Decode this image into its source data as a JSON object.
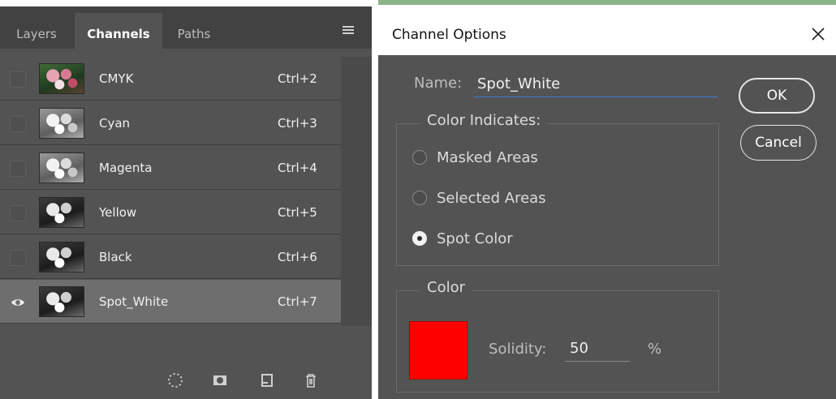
{
  "colors": {
    "panel_bg": "#535353",
    "tab_bar_bg": "#424242",
    "selected_row_bg": "#6e6e6e",
    "input_underline_accent": "#3a7bd5",
    "spot_color": "#ff0000"
  },
  "channels_panel": {
    "tabs": [
      {
        "label": "Layers",
        "active": false
      },
      {
        "label": "Channels",
        "active": true
      },
      {
        "label": "Paths",
        "active": false
      }
    ],
    "menu_icon": "hamburger-menu-icon",
    "channels": [
      {
        "name": "CMYK",
        "shortcut": "Ctrl+2",
        "visible": false,
        "selected": false
      },
      {
        "name": "Cyan",
        "shortcut": "Ctrl+3",
        "visible": false,
        "selected": false
      },
      {
        "name": "Magenta",
        "shortcut": "Ctrl+4",
        "visible": false,
        "selected": false
      },
      {
        "name": "Yellow",
        "shortcut": "Ctrl+5",
        "visible": false,
        "selected": false
      },
      {
        "name": "Black",
        "shortcut": "Ctrl+6",
        "visible": false,
        "selected": false
      },
      {
        "name": "Spot_White",
        "shortcut": "Ctrl+7",
        "visible": true,
        "selected": true
      }
    ],
    "bottom_icons": [
      "load-selection-icon",
      "save-selection-mask-icon",
      "new-channel-icon",
      "delete-channel-icon"
    ]
  },
  "dialog": {
    "title": "Channel Options",
    "close_icon": "close-icon",
    "name_label": "Name:",
    "name_value": "Spot_White",
    "ok_label": "OK",
    "cancel_label": "Cancel",
    "color_indicates": {
      "legend": "Color Indicates:",
      "options": [
        {
          "label": "Masked Areas",
          "checked": false
        },
        {
          "label": "Selected Areas",
          "checked": false
        },
        {
          "label": "Spot Color",
          "checked": true
        }
      ]
    },
    "color_group": {
      "legend": "Color",
      "swatch_color": "#ff0000",
      "solidity_label": "Solidity:",
      "solidity_value": "50",
      "unit": "%"
    }
  }
}
